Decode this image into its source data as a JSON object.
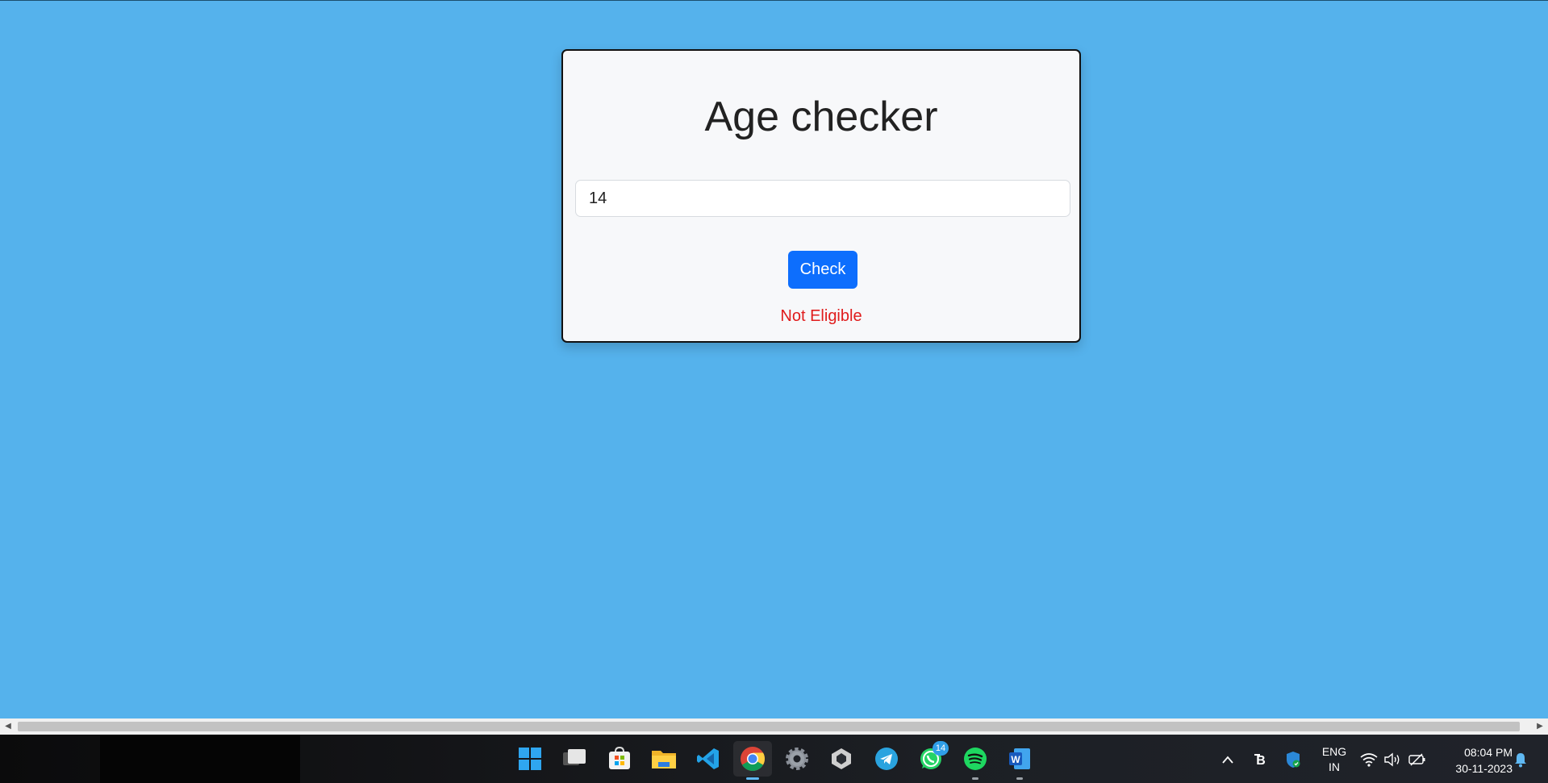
{
  "app": {
    "title": "Age checker",
    "input_value": "14",
    "check_button_label": "Check",
    "result_text": "Not Eligible"
  },
  "colors": {
    "background": "#55b2ec",
    "button": "#0d6efd",
    "result": "#e01c1c"
  },
  "taskbar": {
    "apps": [
      {
        "name": "start-icon"
      },
      {
        "name": "task-view-icon"
      },
      {
        "name": "microsoft-store-icon"
      },
      {
        "name": "file-explorer-icon"
      },
      {
        "name": "vscode-icon"
      },
      {
        "name": "chrome-icon"
      },
      {
        "name": "settings-icon"
      },
      {
        "name": "unity-icon"
      },
      {
        "name": "telegram-icon"
      },
      {
        "name": "whatsapp-icon"
      },
      {
        "name": "spotify-icon"
      },
      {
        "name": "word-icon"
      }
    ],
    "whatsapp_badge": "14",
    "language_line1": "ENG",
    "language_line2": "IN",
    "time": "08:04 PM",
    "date": "30-11-2023"
  }
}
